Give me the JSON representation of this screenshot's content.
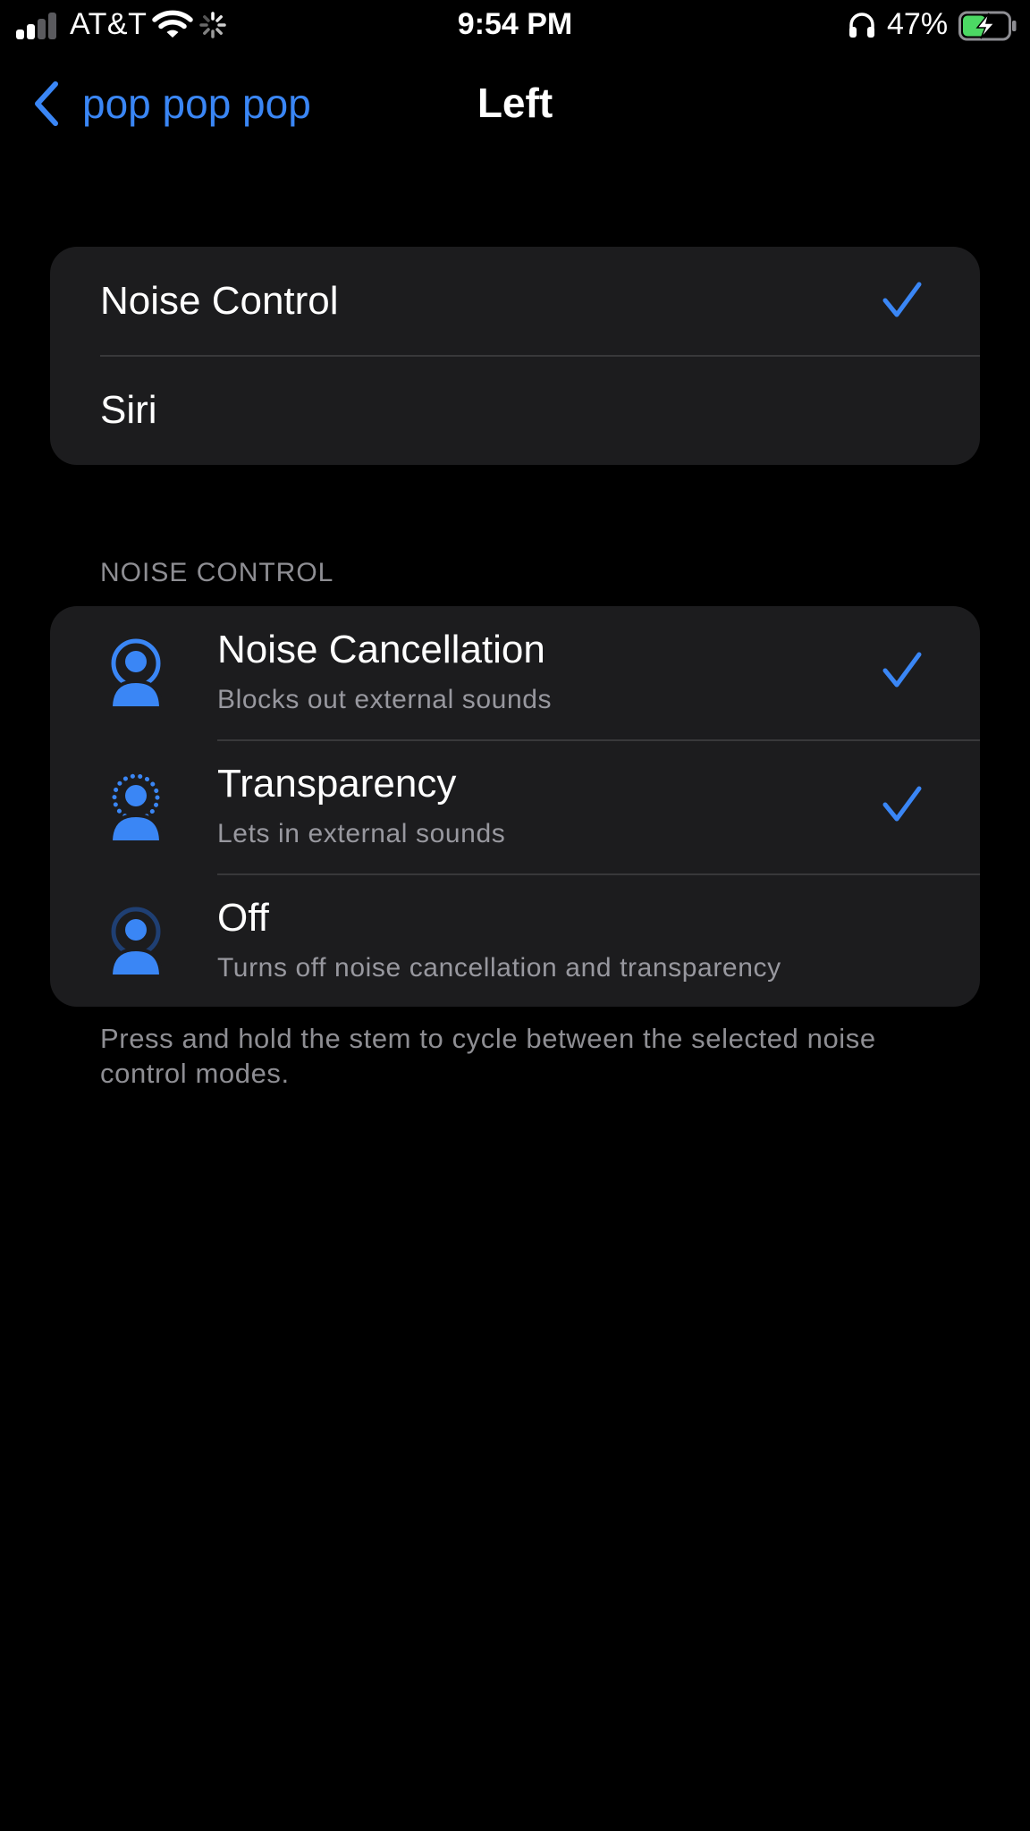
{
  "status_bar": {
    "carrier": "AT&T",
    "time": "9:54 PM",
    "battery_percent": "47%",
    "icons": [
      "cellular-signal-icon",
      "wifi-icon",
      "activity-spinner-icon",
      "headphones-icon",
      "battery-charging-icon"
    ]
  },
  "nav": {
    "back_label": "pop pop pop",
    "title": "Left"
  },
  "press_action_options": [
    {
      "label": "Noise Control",
      "selected": true
    },
    {
      "label": "Siri",
      "selected": false
    }
  ],
  "noise_control": {
    "header": "NOISE CONTROL",
    "modes": [
      {
        "title": "Noise Cancellation",
        "subtitle": "Blocks out external sounds",
        "selected": true
      },
      {
        "title": "Transparency",
        "subtitle": "Lets in external sounds",
        "selected": true
      },
      {
        "title": "Off",
        "subtitle": "Turns off noise cancellation and transparency",
        "selected": false
      }
    ],
    "footer": "Press and hold the stem to cycle between the selected noise control modes."
  },
  "colors": {
    "accent": "#3a86f5",
    "background": "#000000",
    "cell": "#1c1c1e",
    "separator": "#38383a",
    "secondary_text": "#8e8e93",
    "battery_fill": "#4cd964"
  }
}
